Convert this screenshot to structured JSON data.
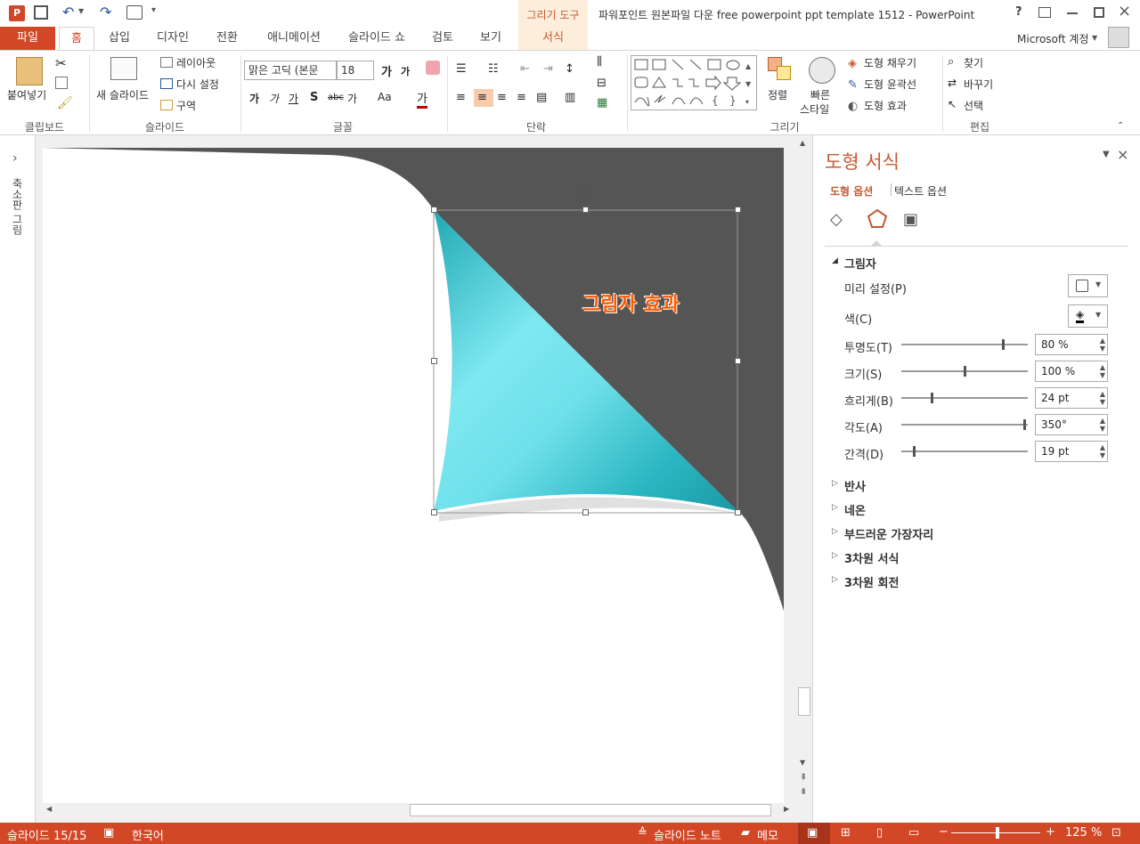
{
  "titlebar": {
    "context_group": "그리기 도구",
    "document_title": "파워포인트 원본파일 다운 free powerpoint ppt template 1512 - PowerPoint",
    "help": "?",
    "account": "Microsoft 계정"
  },
  "tabs": {
    "file": "파일",
    "home": "홈",
    "insert": "삽입",
    "design": "디자인",
    "transitions": "전환",
    "animations": "애니메이션",
    "slideshow": "슬라이드 쇼",
    "review": "검토",
    "view": "보기",
    "format": "서식"
  },
  "ribbon": {
    "clipboard": {
      "paste": "붙여넣기",
      "label": "클립보드"
    },
    "slides": {
      "new_slide": "새 슬라이드",
      "layout": "레이아웃",
      "reset": "다시 설정",
      "section": "구역",
      "label": "슬라이드"
    },
    "font": {
      "font_name": "맑은 고딕 (본문",
      "font_size": "18",
      "label": "글꼴"
    },
    "paragraph": {
      "label": "단락"
    },
    "drawing": {
      "arrange": "정렬",
      "quick_styles_1": "빠른",
      "quick_styles_2": "스타일",
      "shape_fill": "도형 채우기",
      "shape_outline": "도형 윤곽선",
      "shape_effects": "도형 효과",
      "label": "그리기"
    },
    "editing": {
      "find": "찾기",
      "replace": "바꾸기",
      "select": "선택",
      "label": "편집"
    }
  },
  "left_pane": {
    "label": "축소판 그림"
  },
  "slide": {
    "annotation": "그림자 효과"
  },
  "panel": {
    "title": "도형 서식",
    "tab_shape": "도형 옵션",
    "tab_text": "텍스트 옵션",
    "shadow_section": "그림자",
    "presets": "미리 설정(P)",
    "color": "색(C)",
    "transparency": {
      "label": "투명도(T)",
      "value": "80 %",
      "level": 0.8
    },
    "size": {
      "label": "크기(S)",
      "value": "100 %",
      "level": 0.5
    },
    "blur": {
      "label": "흐리게(B)",
      "value": "24 pt",
      "level": 0.24
    },
    "angle": {
      "label": "각도(A)",
      "value": "350°",
      "level": 0.97
    },
    "distance": {
      "label": "간격(D)",
      "value": "19 pt",
      "level": 0.1
    },
    "sections": [
      "반사",
      "네온",
      "부드러운 가장자리",
      "3차원 서식",
      "3차원 회전"
    ]
  },
  "status": {
    "slide_counter": "슬라이드 15/15",
    "language": "한국어",
    "notes": "슬라이드 노트",
    "comments": "메모",
    "zoom_minus": "−",
    "zoom_plus": "+",
    "zoom": "125 %"
  },
  "colors": {
    "accent": "#d24726",
    "panel_title": "#c55a33",
    "annotation": "#ff5a00",
    "shape_fill": "#43c7d2",
    "shadow": "#555555"
  }
}
